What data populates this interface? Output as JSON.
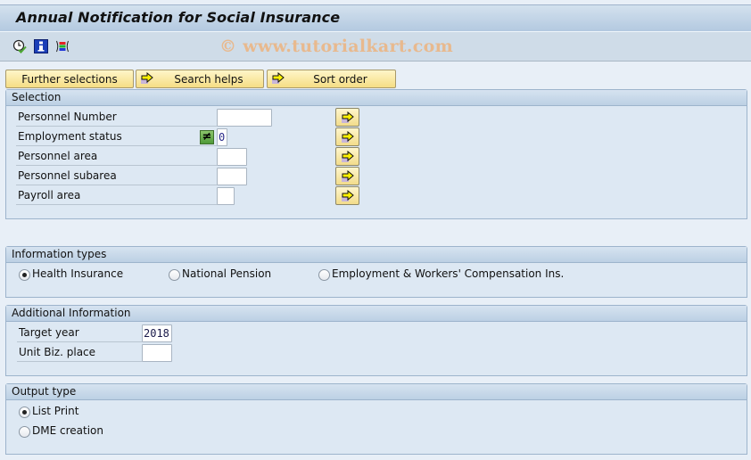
{
  "window": {
    "title": "Annual Notification for Social Insurance",
    "watermark": "© www.tutorialkart.com"
  },
  "toolbar": {
    "icons": [
      "execute-clock-icon",
      "info-icon",
      "selection-options-icon"
    ]
  },
  "top_buttons": [
    {
      "label": "Further selections",
      "icon": null
    },
    {
      "label": "Search helps",
      "icon": "arrow-right-icon"
    },
    {
      "label": "Sort order",
      "icon": "arrow-right-icon"
    }
  ],
  "selection": {
    "title": "Selection",
    "fields": [
      {
        "label": "Personnel Number",
        "value": "",
        "option": null
      },
      {
        "label": "Employment status",
        "value": "0",
        "option": "≠"
      },
      {
        "label": "Personnel area",
        "value": "",
        "option": null
      },
      {
        "label": "Personnel subarea",
        "value": "",
        "option": null
      },
      {
        "label": "Payroll area",
        "value": "",
        "option": null
      }
    ]
  },
  "information_types": {
    "title": "Information types",
    "options": [
      {
        "label": "Health Insurance",
        "selected": true
      },
      {
        "label": "National Pension",
        "selected": false
      },
      {
        "label": "Employment & Workers' Compensation Ins.",
        "selected": false
      }
    ]
  },
  "additional_information": {
    "title": "Additional Information",
    "fields": [
      {
        "label": "Target year",
        "value": "2018"
      },
      {
        "label": "Unit Biz. place",
        "value": ""
      }
    ]
  },
  "output_type": {
    "title": "Output type",
    "options": [
      {
        "label": "List Print",
        "selected": true
      },
      {
        "label": "DME creation",
        "selected": false
      }
    ]
  },
  "colors": {
    "background": "#e8eff7",
    "group_background": "#dde8f3",
    "button_yellow": "#f5dd84",
    "watermark": "#e8b98e",
    "option_green": "#6bb04f"
  }
}
